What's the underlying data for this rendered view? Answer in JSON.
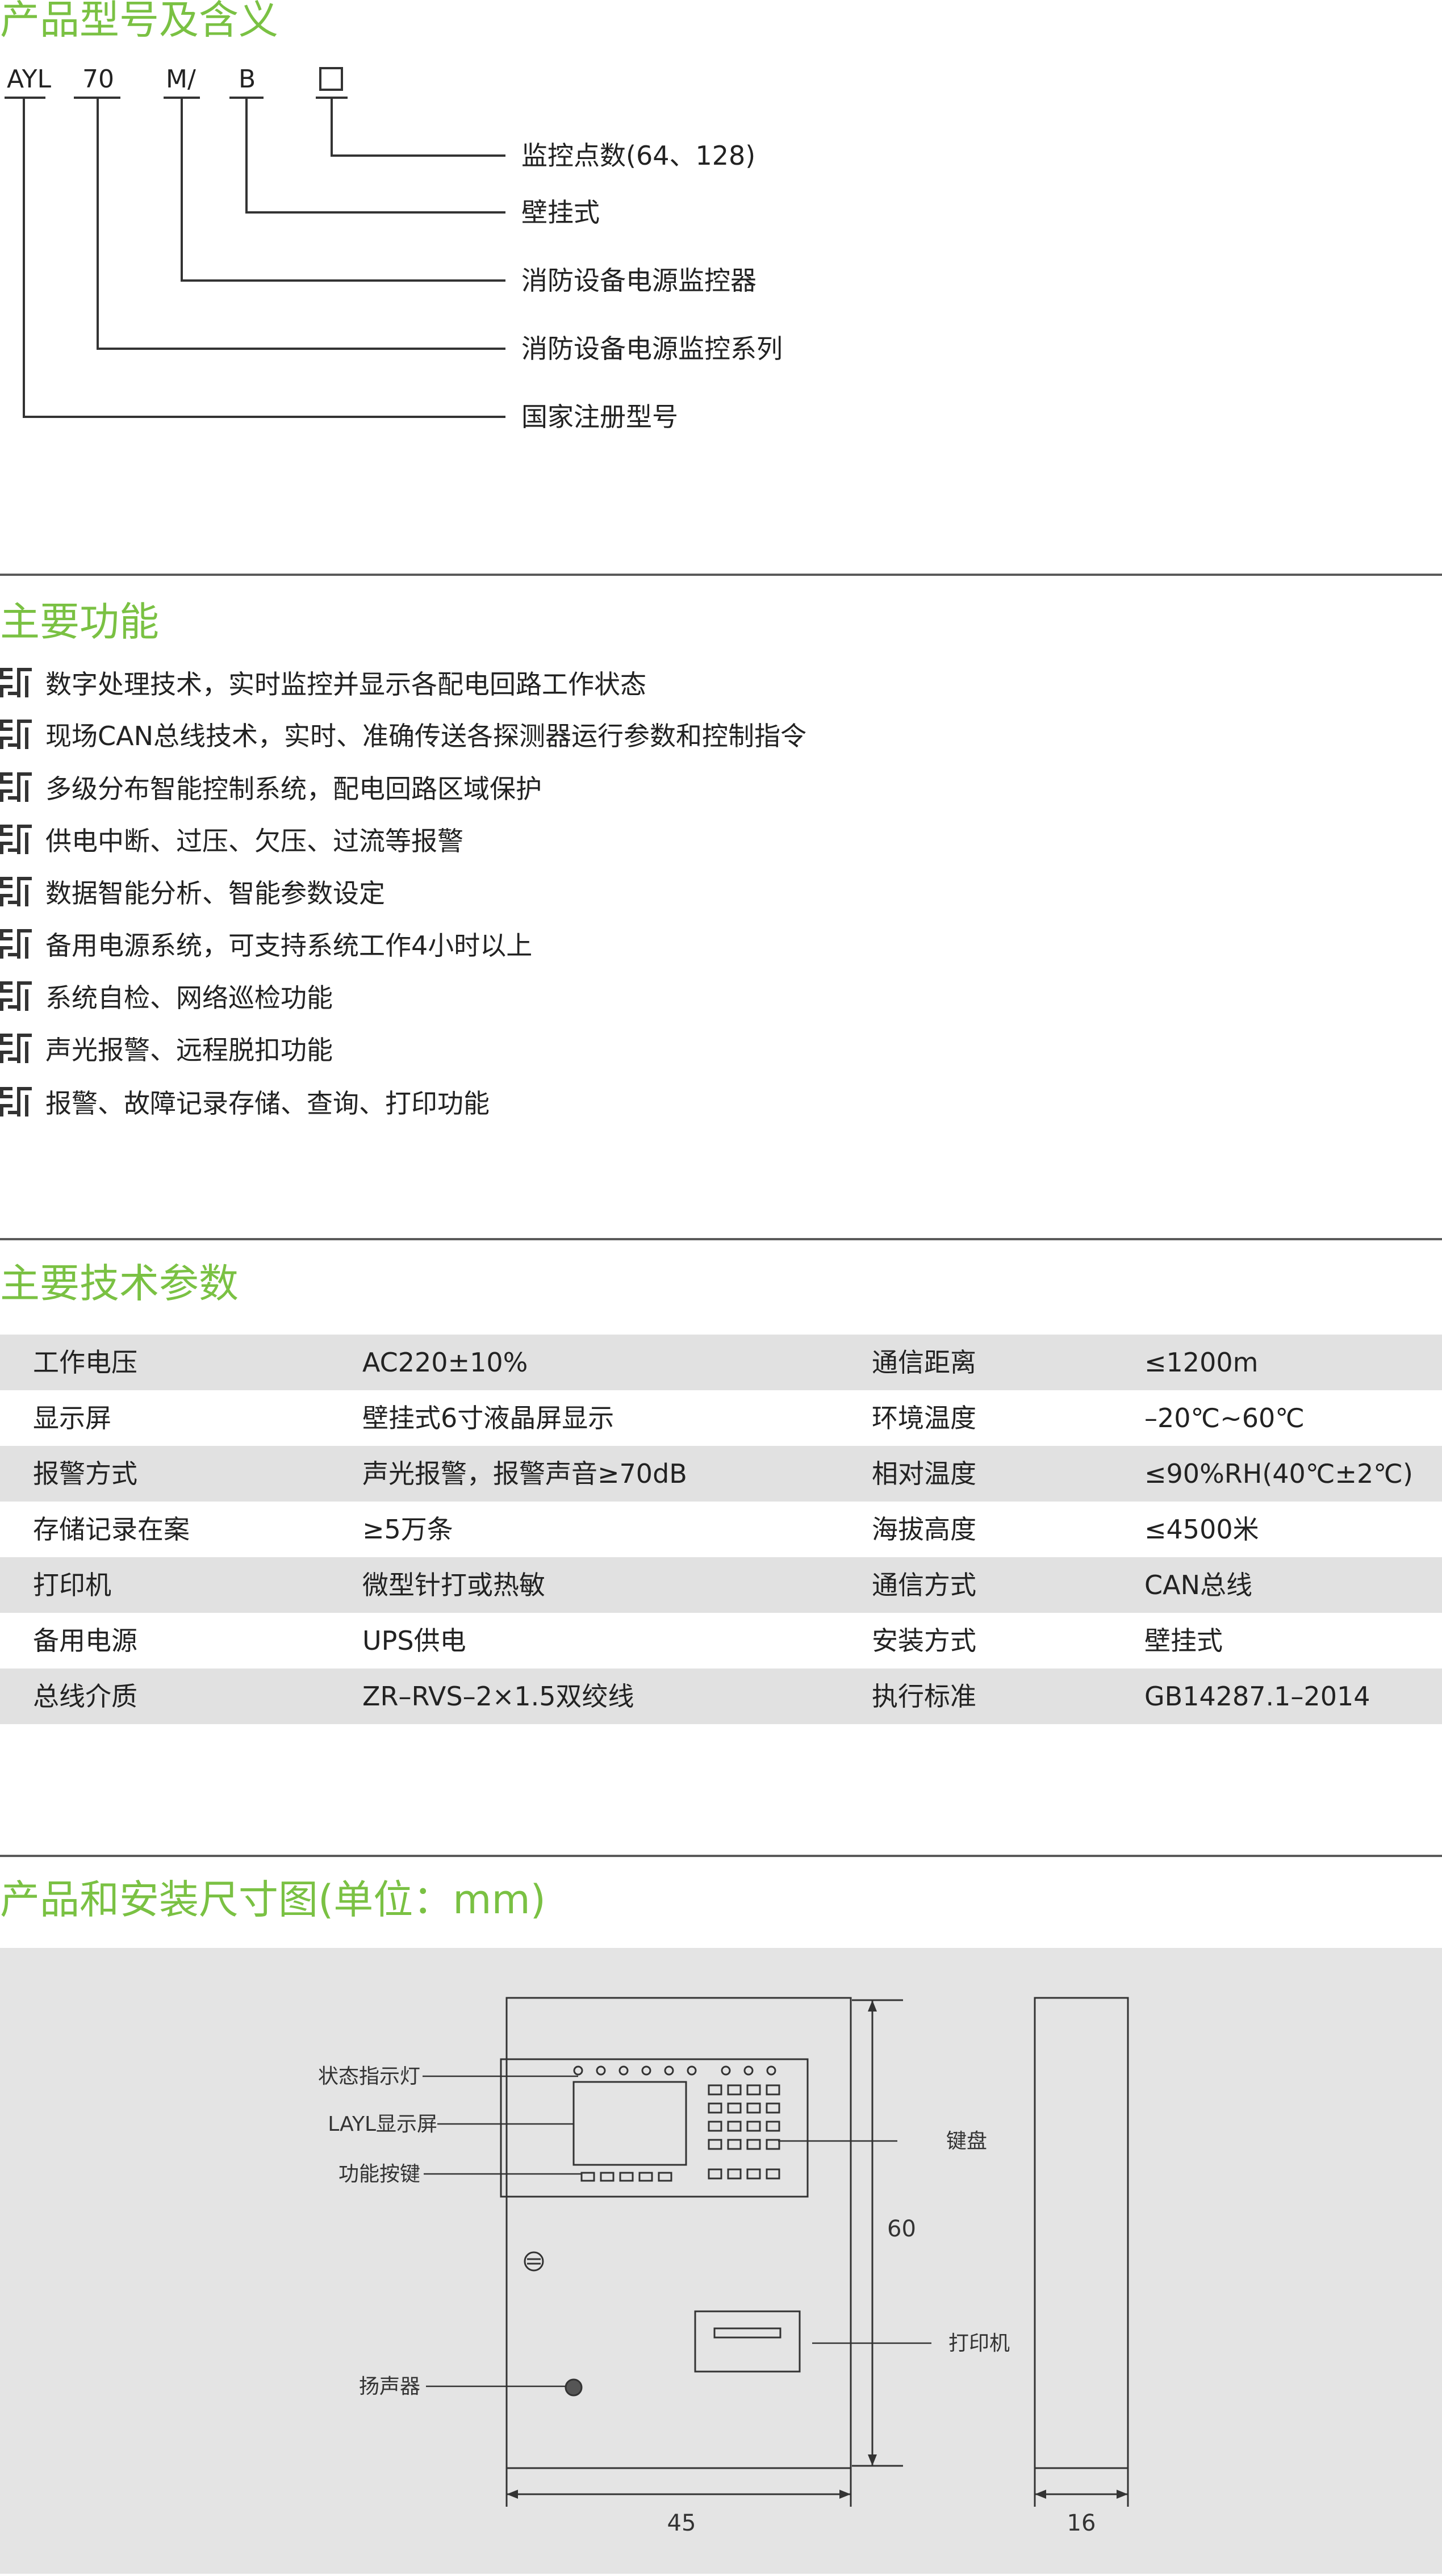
{
  "model_section": {
    "title": "产品型号及含义",
    "codes": [
      "AYL",
      "70",
      "M/",
      "B"
    ],
    "labels": [
      "监控点数(64、128)",
      "壁挂式",
      "消防设备电源监控器",
      "消防设备电源监控系列",
      "国家注册型号"
    ]
  },
  "functions_section": {
    "title": "主要功能",
    "icon": "series-logo-icon",
    "items": [
      "数字处理技术，实时监控并显示各配电回路工作状态",
      "现场CAN总线技术，实时、准确传送各探测器运行参数和控制指令",
      "多级分布智能控制系统，配电回路区域保护",
      "供电中断、过压、欠压、过流等报警",
      "数据智能分析、智能参数设定",
      "备用电源系统，可支持系统工作4小时以上",
      "系统自检、网络巡检功能",
      "声光报警、远程脱扣功能",
      "报警、故障记录存储、查询、打印功能"
    ]
  },
  "params_section": {
    "title": "主要技术参数",
    "rows": [
      [
        "工作电压",
        "AC220±10%",
        "通信距离",
        "≤1200m"
      ],
      [
        "显示屏",
        "壁挂式6寸液晶屏显示",
        "环境温度",
        "–20℃~60℃"
      ],
      [
        "报警方式",
        "声光报警，报警声音≥70dB",
        "相对温度",
        "≤90%RH(40℃±2℃)"
      ],
      [
        "存储记录在案",
        "≥5万条",
        "海拔高度",
        "≤4500米"
      ],
      [
        "打印机",
        "微型针打或热敏",
        "通信方式",
        "CAN总线"
      ],
      [
        "备用电源",
        "UPS供电",
        "安装方式",
        "壁挂式"
      ],
      [
        "总线介质",
        "ZR–RVS–2×1.5双绞线",
        "执行标准",
        "GB14287.1–2014"
      ]
    ]
  },
  "dimension_section": {
    "title": "产品和安装尺寸图(单位：mm)",
    "callouts": {
      "status_light": "状态指示灯",
      "display": "LAYL显示屏",
      "function_keys": "功能按键",
      "keyboard": "键盘",
      "printer": "打印机",
      "speaker": "扬声器"
    },
    "dimensions": {
      "height": "60",
      "width": "45",
      "depth": "16"
    }
  },
  "colors": {
    "accent_green": "#7ac143",
    "rule": "#5a5a5a",
    "row_shade": "#e1e1e1",
    "drawing_bg": "#e4e4e4"
  }
}
